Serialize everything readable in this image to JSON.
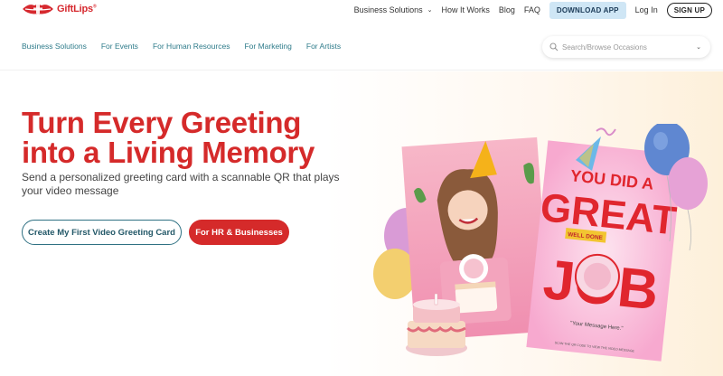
{
  "brand": {
    "name": "GiftLips",
    "mark": "®",
    "red": "#d6282e"
  },
  "topnav": {
    "items": [
      {
        "label": "Business Solutions",
        "has_dropdown": true
      },
      {
        "label": "How It Works"
      },
      {
        "label": "Blog"
      },
      {
        "label": "FAQ"
      }
    ],
    "download_label": "DOWNLOAD APP",
    "login_label": "Log In",
    "signup_label": "SIGN UP"
  },
  "subnav": {
    "links": [
      "Business Solutions",
      "For Events",
      "For Human Resources",
      "For Marketing",
      "For Artists"
    ]
  },
  "search": {
    "placeholder": "Search/Browse Occasions"
  },
  "hero": {
    "headline_line1": "Turn Every Greeting",
    "headline_line2": "into a Living Memory",
    "subtitle": "Send a personalized greeting card with a scannable QR that plays your video message",
    "primary_button": "Create My First Video Greeting Card",
    "secondary_button": "For HR & Businesses"
  },
  "card": {
    "line1": "YOU DID A",
    "line2": "GREAT",
    "banner": "WELL DONE",
    "line3": "JOB",
    "message": "\"Your Message Here.\"",
    "footer": "SCAN THE QR CODE TO VIEW THE VIDEO MESSAGE"
  },
  "colors": {
    "accent_red": "#d52a2a",
    "teal": "#2e7b8a",
    "download_bg": "#cfe6f5"
  }
}
